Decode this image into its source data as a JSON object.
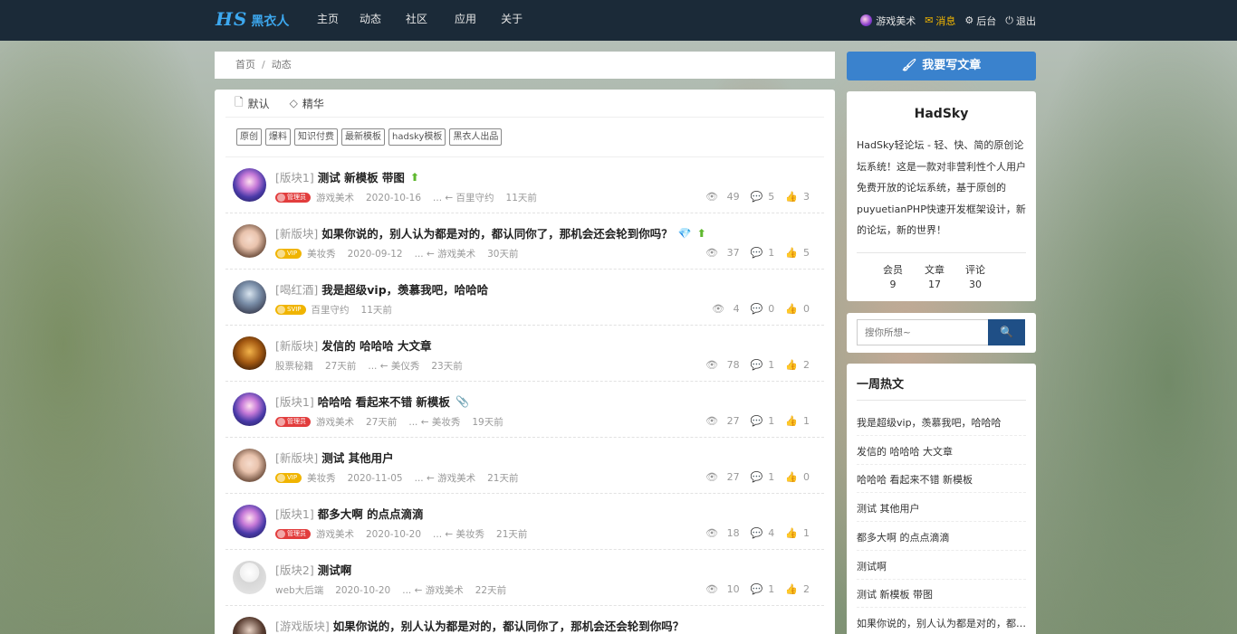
{
  "brand": {
    "logo": "HS",
    "name": "黑衣人"
  },
  "nav": [
    "主页",
    "动态",
    "社区",
    "应用",
    "关于"
  ],
  "user": {
    "name": "游戏美术",
    "messages": "消息",
    "admin": "后台",
    "logout": "退出",
    "msg_color": "#f5b800"
  },
  "breadcrumb": {
    "home": "首页",
    "sep": "/",
    "current": "动态"
  },
  "tabs": [
    "默认",
    "精华"
  ],
  "tags": [
    "原创",
    "爆料",
    "知识付费",
    "最新模板",
    "hadsky模板",
    "黑衣人出品"
  ],
  "posts": [
    {
      "plate": "[版块1]",
      "title": "测试 新模板 带图",
      "author": "游戏美术",
      "role": "管理员",
      "role_type": "admin",
      "date": "2020-10-16",
      "reply": "... ← 百里守约",
      "ago": "11天前",
      "views": "49",
      "comments": "5",
      "likes": "3",
      "avatar": "a1",
      "icons": [
        "up"
      ]
    },
    {
      "plate": "[新版块]",
      "title": "如果你说的，别人认为都是对的，都认同你了，那机会还会轮到你吗？",
      "author": "美妆秀",
      "role": "VIP",
      "role_type": "vip",
      "date": "2020-09-12",
      "reply": "... ← 游戏美术",
      "ago": "30天前",
      "views": "37",
      "comments": "1",
      "likes": "5",
      "avatar": "a2",
      "icons": [
        "diamond",
        "up"
      ]
    },
    {
      "plate": "[喝红酒]",
      "title": "我是超级vip，羡慕我吧，哈哈哈",
      "author": "百里守约",
      "role": "SVIP",
      "role_type": "svip",
      "date": "11天前",
      "reply": "",
      "ago": "",
      "views": "4",
      "comments": "0",
      "likes": "0",
      "avatar": "a3",
      "icons": []
    },
    {
      "plate": "[新版块]",
      "title": "发信的 哈哈哈 大文章",
      "author": "股票秘籍",
      "role": "",
      "role_type": "",
      "date": "27天前",
      "reply": "... ← 美仪秀",
      "ago": "23天前",
      "views": "78",
      "comments": "1",
      "likes": "2",
      "avatar": "a4",
      "icons": []
    },
    {
      "plate": "[版块1]",
      "title": "哈哈哈 看起来不错 新模板",
      "author": "游戏美术",
      "role": "管理员",
      "role_type": "admin",
      "date": "27天前",
      "reply": "... ← 美妆秀",
      "ago": "19天前",
      "views": "27",
      "comments": "1",
      "likes": "1",
      "avatar": "a1",
      "icons": [
        "clip"
      ]
    },
    {
      "plate": "[新版块]",
      "title": "测试 其他用户",
      "author": "美妆秀",
      "role": "VIP",
      "role_type": "vip",
      "date": "2020-11-05",
      "reply": "... ← 游戏美术",
      "ago": "21天前",
      "views": "27",
      "comments": "1",
      "likes": "0",
      "avatar": "a2",
      "icons": []
    },
    {
      "plate": "[版块1]",
      "title": "都多大啊 的点点滴滴",
      "author": "游戏美术",
      "role": "管理员",
      "role_type": "admin",
      "date": "2020-10-20",
      "reply": "... ← 美妆秀",
      "ago": "21天前",
      "views": "18",
      "comments": "4",
      "likes": "1",
      "avatar": "a1",
      "icons": []
    },
    {
      "plate": "[版块2]",
      "title": "测试啊",
      "author": "web大后端",
      "role": "",
      "role_type": "",
      "date": "2020-10-20",
      "reply": "... ← 游戏美术",
      "ago": "22天前",
      "views": "10",
      "comments": "1",
      "likes": "2",
      "avatar": "a5",
      "icons": []
    },
    {
      "plate": "[游戏版块]",
      "title": "如果你说的，别人认为都是对的，都认同你了，那机会还会轮到你吗？",
      "author": "",
      "role": "",
      "role_type": "",
      "date": "",
      "reply": "",
      "ago": "",
      "views": "",
      "comments": "",
      "likes": "",
      "avatar": "a6",
      "icons": []
    }
  ],
  "sidebar": {
    "write": "我要写文章",
    "site_name": "HadSky",
    "desc": "HadSky轻论坛 - 轻、快、简的原创论坛系统！这是一款对非营利性个人用户免费开放的论坛系统，基于原创的puyuetianPHP快速开发框架设计，新的论坛，新的世界！",
    "stats": [
      {
        "label": "会员",
        "value": "9"
      },
      {
        "label": "文章",
        "value": "17"
      },
      {
        "label": "评论",
        "value": "30"
      }
    ],
    "search_placeholder": "搜你所想~",
    "hot_title": "一周热文",
    "hot": [
      "我是超级vip，羡慕我吧，哈哈哈",
      "发信的 哈哈哈 大文章",
      "哈哈哈 看起来不错 新模板",
      "测试 其他用户",
      "都多大啊 的点点滴滴",
      "测试啊",
      "测试 新模板 带图",
      "如果你说的，别人认为都是对的，都认同你了，那机会还会轮到你吗？"
    ]
  },
  "colors": {
    "nav_bg": "#1b2a38",
    "brand": "#3da8ef",
    "button": "#3a82cd",
    "search_btn": "#1f4f86"
  }
}
